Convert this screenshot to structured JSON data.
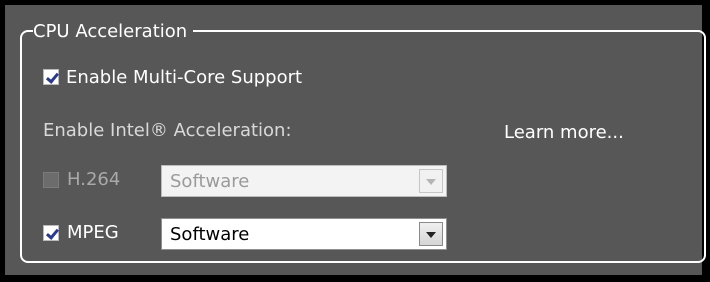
{
  "cpu_acceleration": {
    "title": "CPU Acceleration",
    "multi_core": {
      "label": "Enable Multi-Core Support",
      "checked": true
    },
    "intel_label": "Enable Intel® Acceleration:",
    "learn_more": "Learn more...",
    "rows": [
      {
        "label": "H.264",
        "checked": false,
        "disabled": true,
        "select_value": "Software"
      },
      {
        "label": "MPEG",
        "checked": true,
        "disabled": false,
        "select_value": "Software"
      }
    ]
  }
}
